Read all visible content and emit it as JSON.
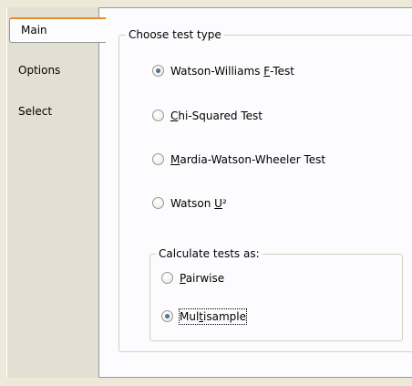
{
  "tabs": {
    "main": "Main",
    "options": "Options",
    "select": "Select"
  },
  "test_type_group": {
    "title": "Choose test type",
    "options": [
      {
        "pre": "Watson-Williams ",
        "ul": "F",
        "post": "-Test",
        "selected": true
      },
      {
        "pre": "",
        "ul": "C",
        "post": "hi-Squared Test",
        "selected": false
      },
      {
        "pre": "",
        "ul": "M",
        "post": "ardia-Watson-Wheeler Test",
        "selected": false
      },
      {
        "pre": "Watson ",
        "ul": "U",
        "post": "²",
        "selected": false
      }
    ]
  },
  "calc_group": {
    "title": "Calculate tests as:",
    "options": [
      {
        "pre": "",
        "ul": "P",
        "post": "airwise",
        "selected": false
      },
      {
        "pre": "Mul",
        "ul": "t",
        "post": "isample",
        "selected": true
      }
    ]
  },
  "colors": {
    "window_bg": "#ece9d8",
    "page_bg": "#fcfcfe",
    "active_tab_accent": "#e68b2c",
    "radio_dot": "#34527a"
  }
}
